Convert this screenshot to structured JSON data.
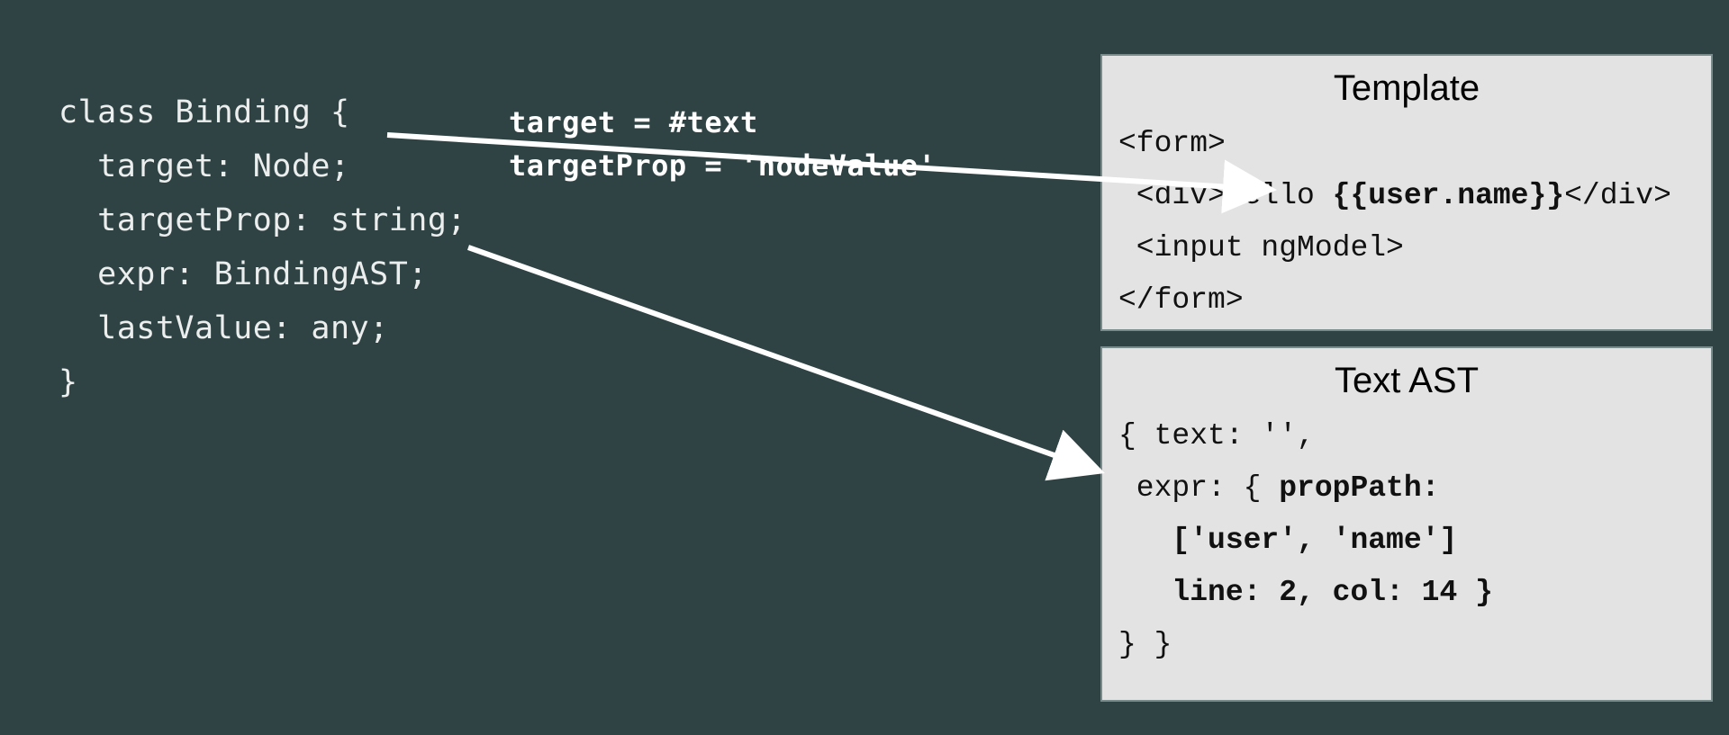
{
  "code": {
    "line1": "class Binding {",
    "line2": "  target: Node;",
    "line3": "  targetProp: string;",
    "line4": "  expr: BindingAST;",
    "line5": "  lastValue: any;",
    "line6": "}"
  },
  "annotation": {
    "line1": "target = #text",
    "line2": "targetProp = 'nodeValue'"
  },
  "template_panel": {
    "title": "Template",
    "l1a": "<form>",
    "l2a": " <div>Hello ",
    "l2b": "{{user.name}}",
    "l2c": "</div>",
    "l3a": " <input ngModel>",
    "l4a": "</form>"
  },
  "ast_panel": {
    "title": "Text AST",
    "l1": "{ text: '',",
    "l2a": " expr: { ",
    "l2b": "propPath:",
    "l3": "   ['user', 'name']",
    "l4": "   line: 2, col: 14 }",
    "l5": "} }"
  }
}
